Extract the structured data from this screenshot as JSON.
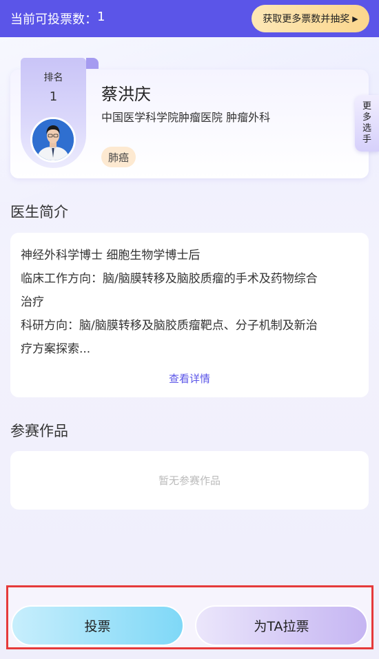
{
  "header": {
    "votes_label": "当前可投票数：",
    "votes_count": "1",
    "more_votes_button": "获取更多票数并抽奖",
    "more_votes_arrow": "▶"
  },
  "doctor": {
    "rank_label": "排名",
    "rank_value": "1",
    "name": "蔡洪庆",
    "hospital": "中国医学科学院肿瘤医院 肿瘤外科",
    "tag": "肺癌"
  },
  "side_tab": {
    "chars": [
      "更",
      "多",
      "选",
      "手"
    ]
  },
  "intro": {
    "title": "医生简介",
    "lines": [
      "神经外科学博士 细胞生物学博士后",
      "临床工作方向：脑/脑膜转移及脑胶质瘤的手术及药物综合",
      "治疗",
      "科研方向：脑/脑膜转移及脑胶质瘤靶点、分子机制及新治",
      "疗方案探索..."
    ],
    "detail_link": "查看详情"
  },
  "works": {
    "title": "参赛作品",
    "empty_text": "暂无参赛作品"
  },
  "actions": {
    "vote_button": "投票",
    "canvass_button": "为TA拉票"
  },
  "colors": {
    "header_bg": "#5b55e8",
    "highlight_frame": "#e53a3a",
    "link": "#5b55e8"
  }
}
